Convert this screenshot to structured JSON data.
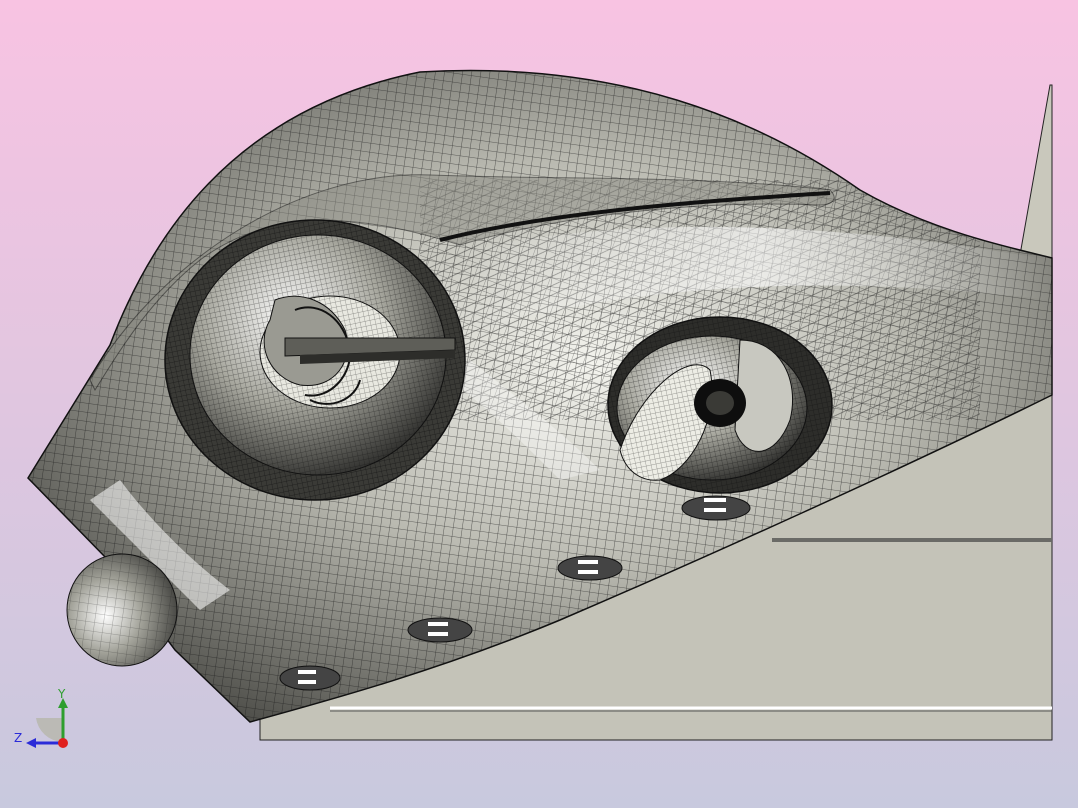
{
  "viewport": {
    "background_top": "#F8C3E2",
    "background_bottom": "#C8C9DE",
    "surface_color": "#C9C8BC",
    "mesh_color": "#1E1E1E",
    "display_mode": "shaded-with-mesh"
  },
  "model": {
    "description_icon": "3d-mesh-model",
    "features": [
      "body",
      "eye-socket",
      "spiral-insert",
      "oval-socket",
      "vent-slots",
      "nose-bulb",
      "base-plate",
      "rear-fin"
    ]
  },
  "triad": {
    "y_label": "Y",
    "z_label": "Z",
    "y_color": "#2E9E2E",
    "z_color": "#2B2BD8",
    "x_color": "#E0201E"
  }
}
